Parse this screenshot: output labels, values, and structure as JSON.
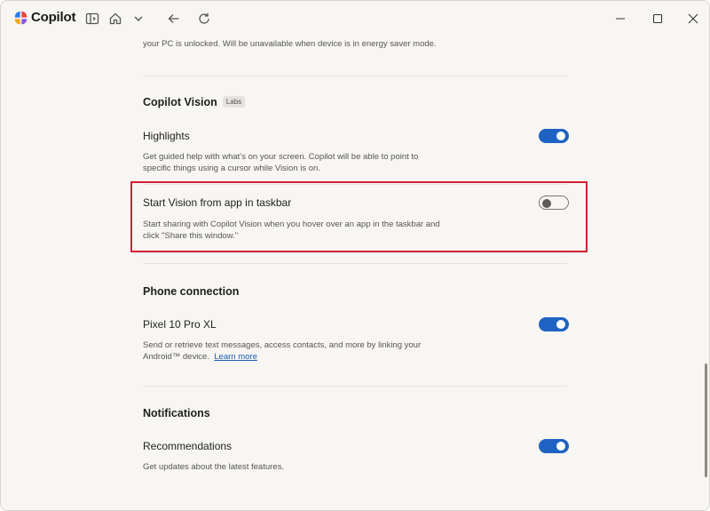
{
  "app": {
    "title": "Copilot",
    "logo_icon": "copilot-logo-icon",
    "toolbar_icons": [
      "sidebar-toggle-icon",
      "home-icon",
      "chevron-down-icon",
      "back-arrow-icon",
      "refresh-icon"
    ],
    "window_controls": [
      "minimize-icon",
      "maximize-icon",
      "close-icon"
    ]
  },
  "top_text": "your PC is unlocked. Will be unavailable when device is in energy saver mode.",
  "sections": {
    "vision": {
      "title": "Copilot Vision",
      "badge": "Labs",
      "highlights": {
        "title": "Highlights",
        "desc1": "Get guided help with what’s on your screen. Copilot will be able to point to",
        "desc2": "specific things using a cursor while Vision is on.",
        "toggle": "on"
      },
      "start_vision": {
        "title": "Start Vision from app in taskbar",
        "desc1": "Start sharing with Copilot Vision when you hover over an app in the taskbar and",
        "desc2": "click \"Share this window.\"",
        "toggle": "off"
      }
    },
    "phone": {
      "title": "Phone connection",
      "device": {
        "title": "Pixel 10 Pro XL",
        "desc1": "Send or retrieve text messages, access contacts, and more by linking your",
        "desc2": "Android™ device.",
        "link": "Learn more",
        "toggle": "on"
      }
    },
    "notifications": {
      "title": "Notifications",
      "recommendations": {
        "title": "Recommendations",
        "desc": "Get updates about the latest features.",
        "toggle": "on"
      }
    }
  },
  "colors": {
    "accent": "#1e63c4",
    "highlight_border": "#d21f34",
    "background": "#f8f6f2"
  }
}
